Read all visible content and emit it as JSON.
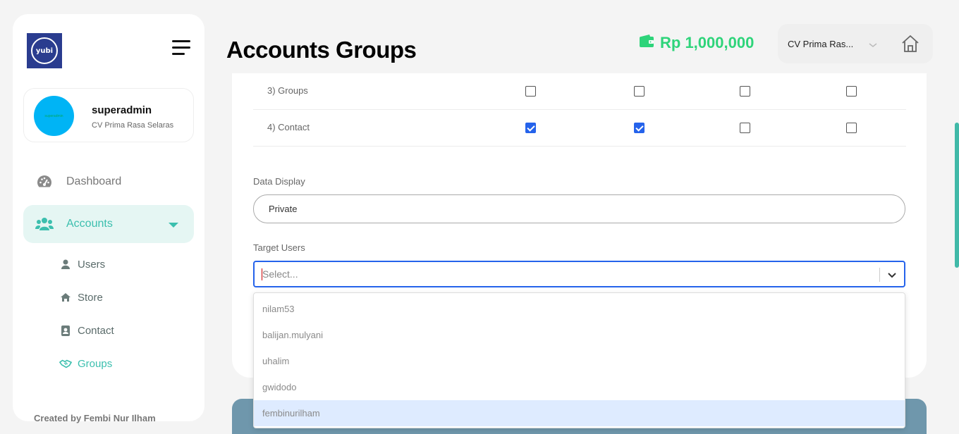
{
  "sidebar": {
    "logo_text": "yubi",
    "profile": {
      "name": "superadmin",
      "company": "CV Prima Rasa Selaras",
      "avatar_text": "superadmin"
    },
    "nav": {
      "dashboard": "Dashboard",
      "accounts": "Accounts",
      "sub": {
        "users": "Users",
        "store": "Store",
        "contact": "Contact",
        "groups": "Groups"
      }
    },
    "credit": "Created by Fembi Nur Ilham"
  },
  "header": {
    "title": "Accounts Groups",
    "balance": "Rp 1,000,000",
    "company_select": "CV Prima Ras..."
  },
  "permissions": [
    {
      "label": "3) Groups",
      "checks": [
        false,
        false,
        false,
        false
      ]
    },
    {
      "label": "4) Contact",
      "checks": [
        true,
        true,
        false,
        false
      ]
    }
  ],
  "form": {
    "data_display": {
      "label": "Data Display",
      "value": "Private"
    },
    "target_users": {
      "label": "Target Users",
      "placeholder": "Select..."
    }
  },
  "dropdown_options": [
    "nilam53",
    "balijan.mulyani",
    "uhalim",
    "gwidodo",
    "fembinurilham"
  ],
  "highlighted_option": "fembinurilham",
  "colors": {
    "accent": "#3bbfae",
    "balance": "#2ed47a",
    "focus": "#2563eb",
    "logo_bg": "#2a3c8f",
    "avatar": "#00b4f5"
  },
  "icons": {
    "menu": "hamburger-icon",
    "dashboard": "gauge-icon",
    "accounts": "users-group-icon",
    "users": "user-icon",
    "store": "home-icon",
    "contact": "contact-book-icon",
    "groups": "handshake-icon",
    "wallet": "wallet-icon",
    "home": "home-icon",
    "chevron": "chevron-down-icon"
  }
}
